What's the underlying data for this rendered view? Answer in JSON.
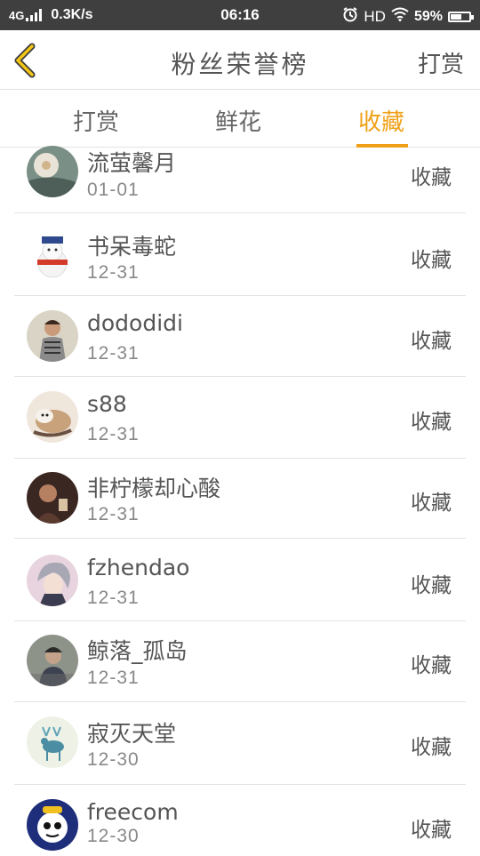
{
  "status_bar": {
    "network": "4G",
    "speed": "0.3K/s",
    "time": "06:16",
    "hd": "HD",
    "battery": "59%",
    "battery_level": 0.59
  },
  "header": {
    "title": "粉丝荣誉榜",
    "action_label": "打赏",
    "back_icon": "chevron-left-icon"
  },
  "tabs": [
    {
      "label": "打赏",
      "active": false
    },
    {
      "label": "鲜花",
      "active": false
    },
    {
      "label": "收藏",
      "active": true
    }
  ],
  "colors": {
    "accent": "#f0a018",
    "text": "#555555",
    "subtext": "#888888",
    "divider": "#e2e2e2"
  },
  "fans": [
    {
      "name": "流萤馨月",
      "date": "01-01",
      "status": "收藏",
      "avatar": "flower-avatar"
    },
    {
      "name": "书呆毒蛇",
      "date": "12-31",
      "status": "收藏",
      "avatar": "snowman-avatar"
    },
    {
      "name": "dododidi",
      "date": "12-31",
      "status": "收藏",
      "avatar": "person-avatar"
    },
    {
      "name": "s88",
      "date": "12-31",
      "status": "收藏",
      "avatar": "cat-avatar"
    },
    {
      "name": "非柠檬却心酸",
      "date": "12-31",
      "status": "收藏",
      "avatar": "dark-photo-avatar"
    },
    {
      "name": "fzhendao",
      "date": "12-31",
      "status": "收藏",
      "avatar": "anime-avatar"
    },
    {
      "name": "鲸落_孤岛",
      "date": "12-31",
      "status": "收藏",
      "avatar": "photo-avatar"
    },
    {
      "name": "寂灭天堂",
      "date": "12-30",
      "status": "收藏",
      "avatar": "deer-avatar"
    },
    {
      "name": "freecom",
      "date": "12-30",
      "status": "收藏",
      "avatar": "robot-avatar"
    }
  ]
}
